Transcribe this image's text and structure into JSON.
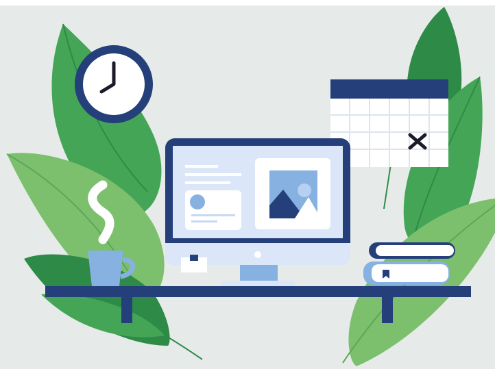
{
  "scene": {
    "description_free": true,
    "colors": {
      "background": "#e6ebe9",
      "leaf_dark": "#2e8a47",
      "leaf_mid": "#45a556",
      "leaf_light": "#7cc06d",
      "navy": "#243f7a",
      "blue_light": "#86b1e0",
      "screen_bg": "#dbe7f8",
      "white": "#ffffff",
      "steam": "#ffffff"
    },
    "icons": [
      "wall-clock-icon",
      "calendar-icon",
      "monitor-icon",
      "image-placeholder-icon",
      "coffee-cup-icon",
      "book-stack-icon",
      "sticky-note-icon"
    ],
    "calendar": {
      "grid_columns": 6,
      "grid_rows": 4,
      "marked_cell": "x"
    },
    "clock": {
      "hour_hand": "7",
      "minute_hand": "12"
    }
  }
}
